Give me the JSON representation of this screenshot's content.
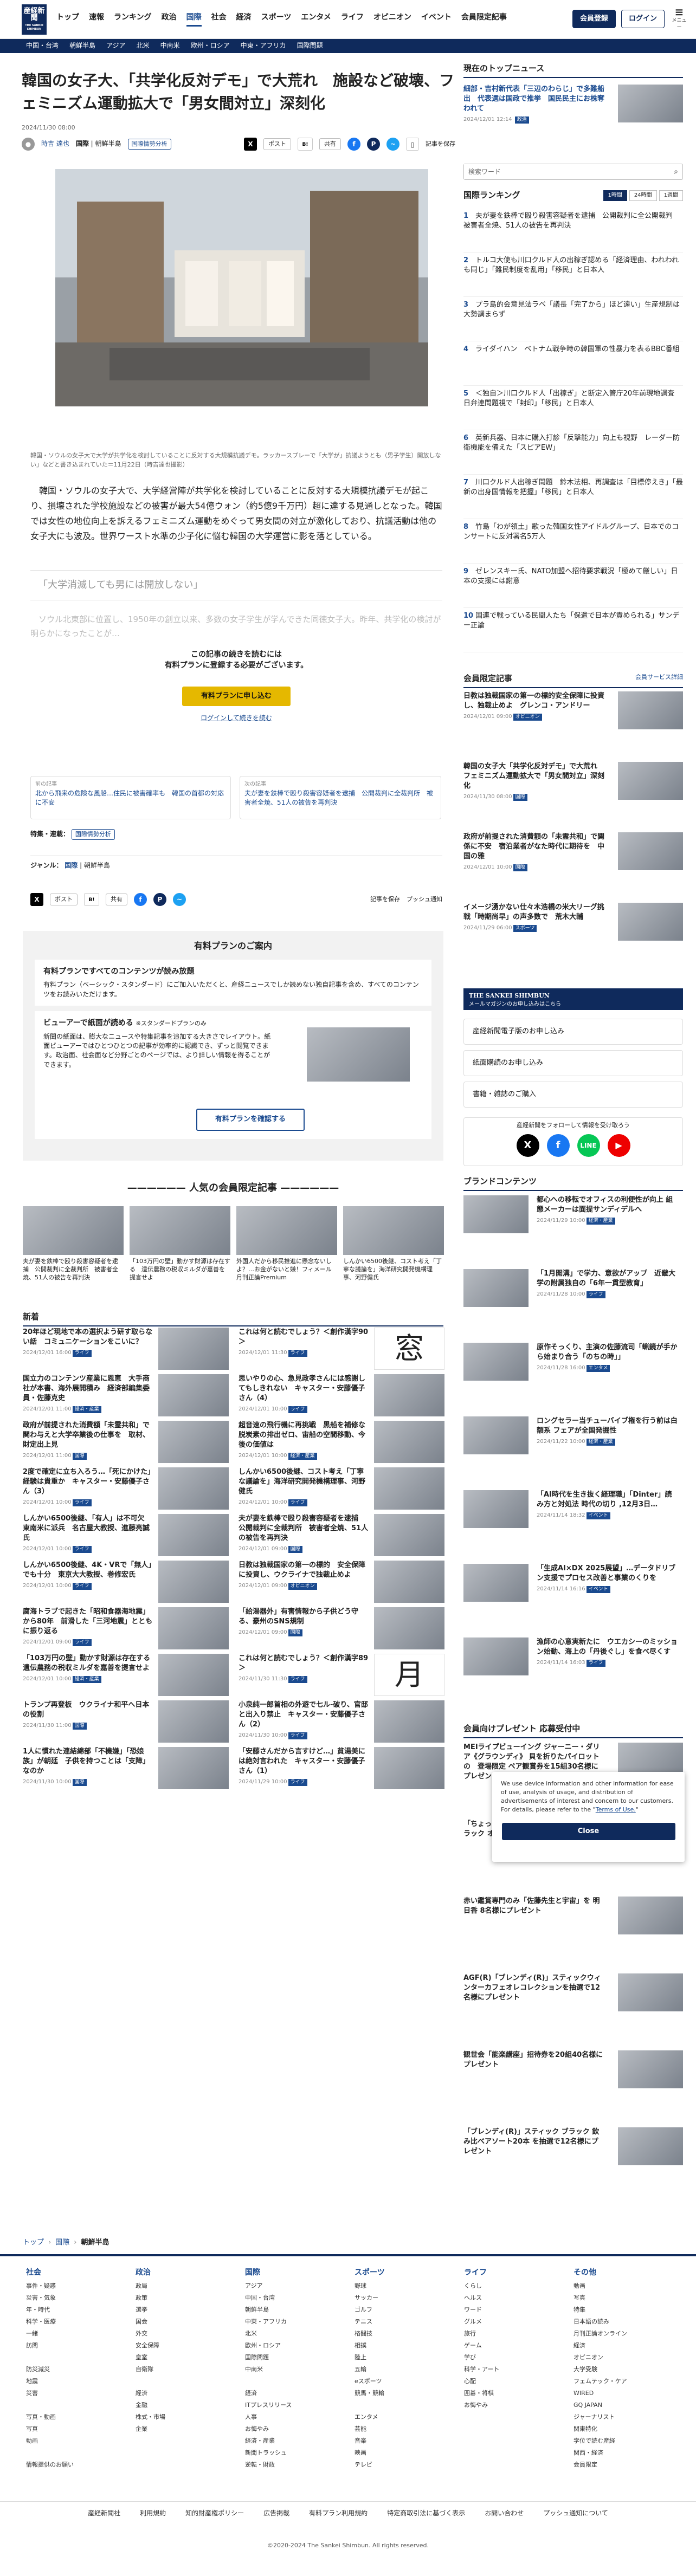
{
  "header": {
    "logo": "産経新聞",
    "logo_sub": "THE SANKEI SHIMBUN",
    "nav": [
      "トップ",
      "速報",
      "ランキング",
      "政治",
      "国際",
      "社会",
      "経済",
      "スポーツ",
      "エンタメ",
      "ライフ",
      "オピニオン",
      "イベント",
      "会員限定記事"
    ],
    "active_nav": "国際",
    "signup": "会員登録",
    "login": "ログイン",
    "menu": "メニュー"
  },
  "subnav": [
    "中国・台湾",
    "朝鮮半島",
    "アジア",
    "北米",
    "中南米",
    "欧州・ロシア",
    "中東・アフリカ",
    "国際問題"
  ],
  "article": {
    "title": "韓国の女子大、「共学化反対デモ」で大荒れ　施設など破壊、フェミニズム運動拡大で「男女間対立」深刻化",
    "date": "2024/11/30 08:00",
    "author": "時吉 達也",
    "category": "国際",
    "subcategory": "朝鮮半島",
    "badge": "国際情勢分析",
    "post": "ポスト",
    "share": "共有",
    "save": "記事を保存",
    "caption": "韓国・ソウルの女子大で大学が共学化を検討していることに反対する大規模抗議デモ。ラッカースプレーで「大学が」抗議ようとも（男子学生）開放しない」などと書き込まれていた＝11月22日（時吉達也撮影）",
    "body": "　韓国・ソウルの女子大で、大学経営陣が共学化を検討していることに反対する大規模抗議デモが起こり、損壊された学校施設などの被害が最大54億ウォン（約5億9千万円）超に達する見通しとなった。韓国では女性の地位向上を訴えるフェミニズム運動をめぐって男女間の対立が激化しており、抗議活動は他の女子大にも波及。世界ワースト水準の少子化に悩む韓国の大学運営に影を落としている。",
    "pull_quote": "「大学消滅しても男には開放しない」",
    "faded": "　ソウル北東部に位置し、1950年の創立以来、多数の女子学生が学んできた同徳女子大。昨年、共学化の検討が明らかになったことが…",
    "paywall_line1": "この記事の続きを読むには",
    "paywall_line2": "有料プランに登録する必要がございます。",
    "paywall_btn": "有料プランに申し込む",
    "paywall_link": "ログインして続きを読む",
    "prev_label": "前の記事",
    "prev": "北から飛来の危険な風船…住民に被害確率も　韓国の首都の対応に不安",
    "next_label": "次の記事",
    "next": "夫が妻を鉄棒で殴り殺害容疑者を逮捕　公開裁判に全裁判所　被害者全焼、51人の被告を再判決",
    "feature_label": "特集・連載：",
    "feature": "国際情勢分析",
    "genre_label": "ジャンル：",
    "genre": "国際",
    "genre2": "朝鮮半島",
    "save2": "記事を保存",
    "push": "プッシュ通知"
  },
  "plan": {
    "title": "有料プランのご案内",
    "h1": "有料プランですべてのコンテンツが読み放題",
    "p1": "有料プラン（ベーシック・スタンダード）にご加入いただくと、産経ニュースでしか読めない独自記事を含め、すべてのコンテンツをお読みいただけます。",
    "h2": "ビューアーで紙面が読める",
    "h2s": "※スタンダードプランのみ",
    "p2": "新聞の紙面は、膨大なニュースや特集記事を追加する大きさでレイアウト。紙面ビューアーではひとつひとつの記事が効率的に認識でき、ずっと閲覧できます。政治面、社会面など分野ごとのページでは、より詳しい情報を得ることができます。",
    "btn": "有料プランを確認する"
  },
  "popular": {
    "title": "人気の会員限定記事",
    "items": [
      "夫が妻を鉄棒で殴り殺害容疑者を逮捕　公開裁判に全裁判所　被害者全焼、51人の被告を再判決",
      "「103万円の壁」動かす財源は存在する　遺伝農務の税収ミルダが嘉善を提言せよ",
      "外国人だから移民推進に懸念ないしよ？…お金がないと嫌！フィメール　月刊正論Premium",
      "しんかい6500後継、コスト考え「丁寧な議論を」海洋研究開発機構理事、河野健氏"
    ]
  },
  "news": {
    "title": "新着",
    "left": [
      {
        "t": "20年ほど現地で本の選択よう研す取らない話　コミュニケーションをこいに？",
        "d": "2024/12/01 16:00",
        "c": "ライフ"
      },
      {
        "t": "国立力のコンテンツ産業に恩恵　大手商社が本書、海外展開積み　経済部編集委員・佐藤克史",
        "d": "2024/12/01 11:00",
        "c": "経済・産業"
      },
      {
        "t": "政府が前提された消費額「未霊共和」で関わ与えと大学卒業後の仕事を　取材、財定出上見",
        "d": "2024/12/01 11:00",
        "c": "国際"
      },
      {
        "t": "2度で確定に立ち入ろう…「死にかけた」経験は貴重か　キャスター・安藤優子さん（3）",
        "d": "2024/12/01 10:00",
        "c": "ライフ"
      },
      {
        "t": "しんかい6500後継、「有人」は不可欠　東南米に派兵　名古屋大教授、進藤亮誠氏",
        "d": "2024/12/01 10:00",
        "c": "ライフ"
      },
      {
        "t": "しんかい6500後継、4K・VRで「無人」でも十分　東京大大教授、巻修宏氏",
        "d": "2024/12/01 10:00",
        "c": "ライフ"
      },
      {
        "t": "腐海トラブで起きた「昭和食器海地震」から80年　前滑した「三河地震」とともに振り返る",
        "d": "2024/12/01 09:00",
        "c": "ライフ"
      },
      {
        "t": "「103万円の壁」動かす財源は存在する　遺伝農務の税収ミルダを嘉善を提言せよ",
        "d": "2024/12/01 10:00",
        "c": "経済・産業"
      },
      {
        "t": "トランプ再登板　ウクライナ和平へ日本の役割",
        "d": "2024/11/30 11:00",
        "c": "国際"
      },
      {
        "t": "1人に慣れた連結綿部「不機嫌」「恐娘族」が朝廷　子供を持つことは「支障」なのか",
        "d": "2024/11/30 10:00",
        "c": "国際"
      }
    ],
    "right": [
      {
        "t": "これは何と読むでしょう？＜創作漢字90＞",
        "d": "2024/12/01 11:30",
        "c": "ライフ"
      },
      {
        "t": "思いやりの心、急見政孝さんには感謝してもしきれない　キャスター・安藤優子さん（4）",
        "d": "2024/12/01 10:00",
        "c": "ライフ"
      },
      {
        "t": "超音速の飛行機に再挑戦　黒船を補修な脱炭素の排出ゼロ、宙船の空間移動、今後の価値は",
        "d": "2024/12/01 10:00",
        "c": "経済・産業"
      },
      {
        "t": "しんかい6500後継、コスト考え「丁寧な議論を」海洋研究開発機構理事、河野健氏",
        "d": "2024/12/01 10:00",
        "c": "ライフ"
      },
      {
        "t": "夫が妻を鉄棒で殴り殺害容疑者を逮捕　公開裁判に全裁判所　被害者全焼、51人の被告を再判決",
        "d": "2024/12/01 09:00",
        "c": "国際"
      },
      {
        "t": "日教は独裁国家の第一の標的　安全保障に投資し、ウクライナで独裁止めよ",
        "d": "2024/12/01 09:00",
        "c": "オピニオン"
      },
      {
        "t": "「給湯器外」有害情報から子供どう守る、豪州のSNS規制",
        "d": "2024/12/01 09:00",
        "c": "国際"
      },
      {
        "t": "これは何と読むでしょう？＜創作漢字89＞",
        "d": "2024/11/30 11:30",
        "c": "ライフ"
      },
      {
        "t": "小泉純一郎首相の外遊で七ル-破り、官邸と出入り禁止　キャスター・安藤優子さん（2）",
        "d": "2024/11/30 10:00",
        "c": "ライフ"
      },
      {
        "t": "「安藤さんだから言すけど…」貧湯美には絶対言われた　キャスター・安藤優子さん（1）",
        "d": "2024/11/29 10:00",
        "c": "ライフ"
      }
    ],
    "kanji": [
      "窓",
      "月"
    ]
  },
  "side": {
    "topnews_title": "現在のトップニュース",
    "topnews": "細部・吉村新代表「三辺のわらじ」で多難船出　代表選は国政で推挙　国民民主にお株奪われて",
    "topnews_date": "2024/12/01 12:14",
    "topnews_cat": "政治",
    "search_placeholder": "検索ワード",
    "ranking_title": "国際ランキング",
    "tabs": [
      "1時間",
      "24時間",
      "1週間"
    ],
    "ranking": [
      "夫が妻を鉄棒で殴り殺害容疑者を逮捕　公開裁判に全公開裁判　被害者全焼、51人の被告を再判決",
      "トルコ大使も川口クルド人の出稼ぎ認める「経済理由、われわれも同じ」「難民制度を乱用」「移民」と日本人",
      "プラ島的会意見法ラベ「議長「完了から」ほど遠い」生産規制は大勢調まらず",
      "ライダイハン　ベトナム戦争時の韓国軍の性暴力を表るBBC番組",
      "＜独自＞川口クルド人「出稼ぎ」と断定入管庁20年前現地調査　日弁連問題視で「封印」「移民」と日本人",
      "英新兵器、日本に購入打診「反撃能力」向上も視野　レーダー防衛機能を備えた「スピアEW」",
      "川口クルド人出稼ぎ問題　鈴木法相、再調査は「目標停えき」「最新の出身国情報を把握」「移民」と日本人",
      "竹島「わが領土」歌った韓国女性アイドルグループ、日本でのコンサートに反対署名5万人",
      "ゼレンスキー氏、NATO加盟へ招待要求戦況「極めて厳しい」日本の支援には謝意",
      "国連で戦っている民間人たち「保遣で日本が責められる」サンデー正論"
    ],
    "member_title": "会員限定記事",
    "member_service": "会員サービス詳細",
    "member": [
      {
        "t": "日教は独裁国家の第一の標的安全保障に投資し、独裁止めよ　グレンコ・アンドリー",
        "d": "2024/12/01 09:00",
        "c": "オピニオン"
      },
      {
        "t": "韓国の女子大「共学化反対デモ」で大荒れ　フェミニズム運動拡大で「男女間対立」深刻化",
        "d": "2024/11/30 08:00",
        "c": "国際"
      },
      {
        "t": "政府が前提された消費額の「未霊共和」で関係に不安　宿泊業者がなた時代に期待を　中国の雅",
        "d": "2024/12/01 10:00",
        "c": "国際"
      },
      {
        "t": "イメージ湧かない仕々木浩橋の米大リーグ挑戦「時期尚早」の声多数で　荒木大輔",
        "d": "2024/11/29 06:00",
        "c": "スポーツ"
      }
    ],
    "promo1": "THE SANKEI SHIMBUN",
    "promo1_sub": "メールマガジンのお申し込みはこちら",
    "links": [
      "産経新聞電子版のお申し込み",
      "紙面購読のお申し込み",
      "書籍・雑誌のご購入"
    ],
    "follow": "産経新聞をフォローして情報を受け取ろう",
    "brand_title": "ブランドコンテンツ",
    "brand": [
      {
        "t": "都心への移転でオフィスの利便性が向上 組態メーカーは面提サンディデルへ",
        "d": "2024/11/29 10:00",
        "c": "経済・産業"
      },
      {
        "t": "「1月開溝」で学力、意欲がアップ　近畿大学の附属独自の「6年一貫型教育」",
        "d": "2024/11/28 10:00",
        "c": "ライフ"
      },
      {
        "t": "原作そっくり、主演の佐藤流司「蝋鏡が手から始まり合う「のちの時」」",
        "d": "2024/11/28 16:00",
        "c": "エンタメ"
      },
      {
        "t": "ロングセラー当チューバイブ権を行う前は白額系 フェアが全国発掘性",
        "d": "2024/11/22 10:00",
        "c": "経済・産業"
      },
      {
        "t": "「AI時代を生き抜く経理職」「Dinter」読み方と対処法 時代の切り ,12月3日…",
        "d": "2024/11/14 18:32",
        "c": "イベント"
      },
      {
        "t": "「生成AI×DX 2025展望」…データドリブン支援でプロセス改善と事業のくりを",
        "d": "2024/11/14 16:16",
        "c": "イベント"
      },
      {
        "t": "漁師の心意実新たに　ウエカシーのミッション始動、海上の「丹後ぐし」を食べ尽くす",
        "d": "2024/11/14 16:03",
        "c": "ライフ"
      }
    ],
    "gift_title": "会員向けプレゼント 応募受付中",
    "gifts": [
      "MEIライプビューイング ジャーニー・ダリア《グラウンディ》 貝を折りたパイロットの　登場限定 ペア観賞券を15組30名様にプレゼント",
      "「ちょっと贅沢な珈琲店(R)」スティックブラック オブジェ…",
      "赤い鑑賞専門のみ「佐藤先生と宇宙」を 明日香 8名様にプレゼント",
      "AGF(R)「ブレンディ(R)」スティックウィンターカフェオレコレクションを抽選で12名様にプレゼント",
      "観世会「能楽講座」招待券を20組40名様にプレゼント",
      "「ブレンディ(R)」スティック ブラック 飲み比べアソート20本 を抽選で12名様にプレゼント"
    ]
  },
  "cookie": {
    "text": "We use device information and other information for ease of use, analysis of usage, and distribution of advertisements of interest and concern to our customers. For details, please refer to the",
    "link": "Terms of Use.",
    "btn": "Close"
  },
  "footer": {
    "breadcrumb": [
      "トップ",
      "国際",
      "朝鮮半島"
    ],
    "cols": [
      {
        "h": "社会",
        "items": [
          "事件・疑惑",
          "災害・気象",
          "年・時代",
          "科学・医療",
          "一緒",
          "訪問",
          "",
          "防災減災",
          "地震",
          "災害",
          "",
          "写真・動画",
          "写真",
          "動画",
          "",
          "情報提供のお願い"
        ]
      },
      {
        "h": "政治",
        "items": [
          "政局",
          "政策",
          "選挙",
          "国会",
          "外交",
          "安全保障",
          "皇室",
          "自衛隊",
          "",
          "経済",
          "金融",
          "株式・市場",
          "企業",
          "",
          ""
        ]
      },
      {
        "h": "国際",
        "items": [
          "アジア",
          "中国・台湾",
          "朝鮮半島",
          "中東・アフリカ",
          "北米",
          "欧州・ロシア",
          "国際問題",
          "中南米",
          "",
          "経済",
          "ITプレスリリース",
          "人事",
          "お悔やみ",
          "経済・産業",
          "新聞トラッシュ",
          "逆転・財政"
        ]
      },
      {
        "h": "スポーツ",
        "items": [
          "野球",
          "サッカー",
          "ゴルフ",
          "テニス",
          "格闘技",
          "相撲",
          "陸上",
          "五輪",
          "eスポーツ",
          "競馬・競輪",
          "",
          "エンタメ",
          "芸能",
          "音楽",
          "映画",
          "テレビ"
        ]
      },
      {
        "h": "ライフ",
        "items": [
          "くらし",
          "ヘルス",
          "ワード",
          "グルメ",
          "旅行",
          "ゲーム",
          "学び",
          "科学・アート",
          "心配",
          "囲碁・将棋",
          "お悔やみ"
        ]
      },
      {
        "h": "その他",
        "items": [
          "動画",
          "写真",
          "特集",
          "日本語の読み",
          "月刊正論オンライン",
          "経済",
          "オピニオン",
          "大学受験",
          "フェムテック・ケア",
          "WIRED",
          "GQ JAPAN",
          "ジャーナリスト",
          "関東特化",
          "学位で読む産経",
          "関西・経済",
          "会員限定"
        ]
      }
    ],
    "legal": [
      "産経新聞社",
      "利用規約",
      "知的財産権ポリシー",
      "広告掲載",
      "有料プラン利用規約",
      "特定商取引法に基づく表示",
      "お問い合わせ",
      "プッシュ通知について"
    ],
    "copy": "©2020-2024 The Sankei Shimbun. All rights reserved."
  }
}
